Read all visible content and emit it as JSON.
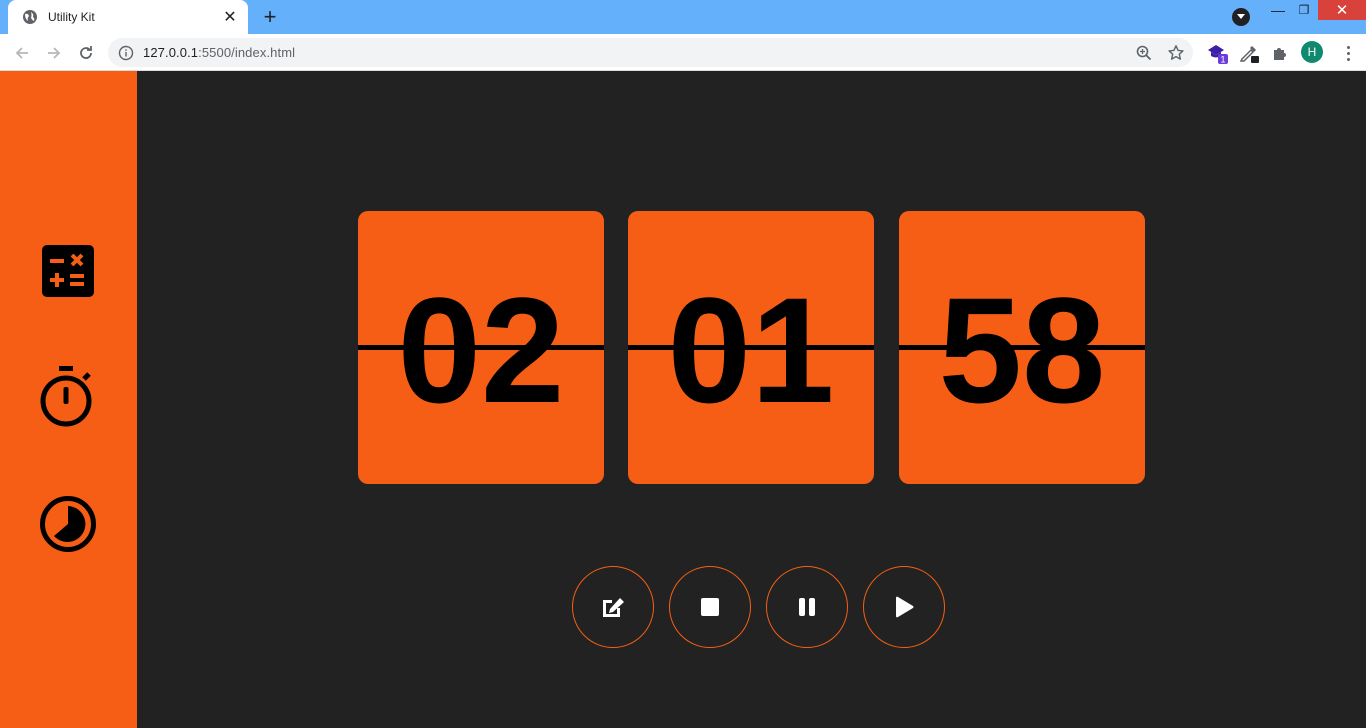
{
  "browser": {
    "tab_title": "Utility Kit",
    "tab_close": "✕",
    "new_tab": "+",
    "url_host": "127.0.0.1",
    "url_path": ":5500/index.html",
    "profile_initial": "H",
    "extension_badge": "1",
    "window": {
      "minimize": "—",
      "maximize": "❐",
      "close": "✕"
    }
  },
  "sidebar": {
    "items": [
      {
        "icon": "calculator-icon"
      },
      {
        "icon": "stopwatch-icon"
      },
      {
        "icon": "timer-icon"
      }
    ]
  },
  "timer": {
    "hours": "02",
    "minutes": "01",
    "seconds": "58"
  },
  "controls": [
    {
      "icon": "edit-icon"
    },
    {
      "icon": "stop-icon"
    },
    {
      "icon": "pause-icon"
    },
    {
      "icon": "play-icon"
    }
  ],
  "colors": {
    "accent": "#f65e15",
    "background": "#222222",
    "tabbar": "#64b0fb",
    "digit": "#000000"
  }
}
